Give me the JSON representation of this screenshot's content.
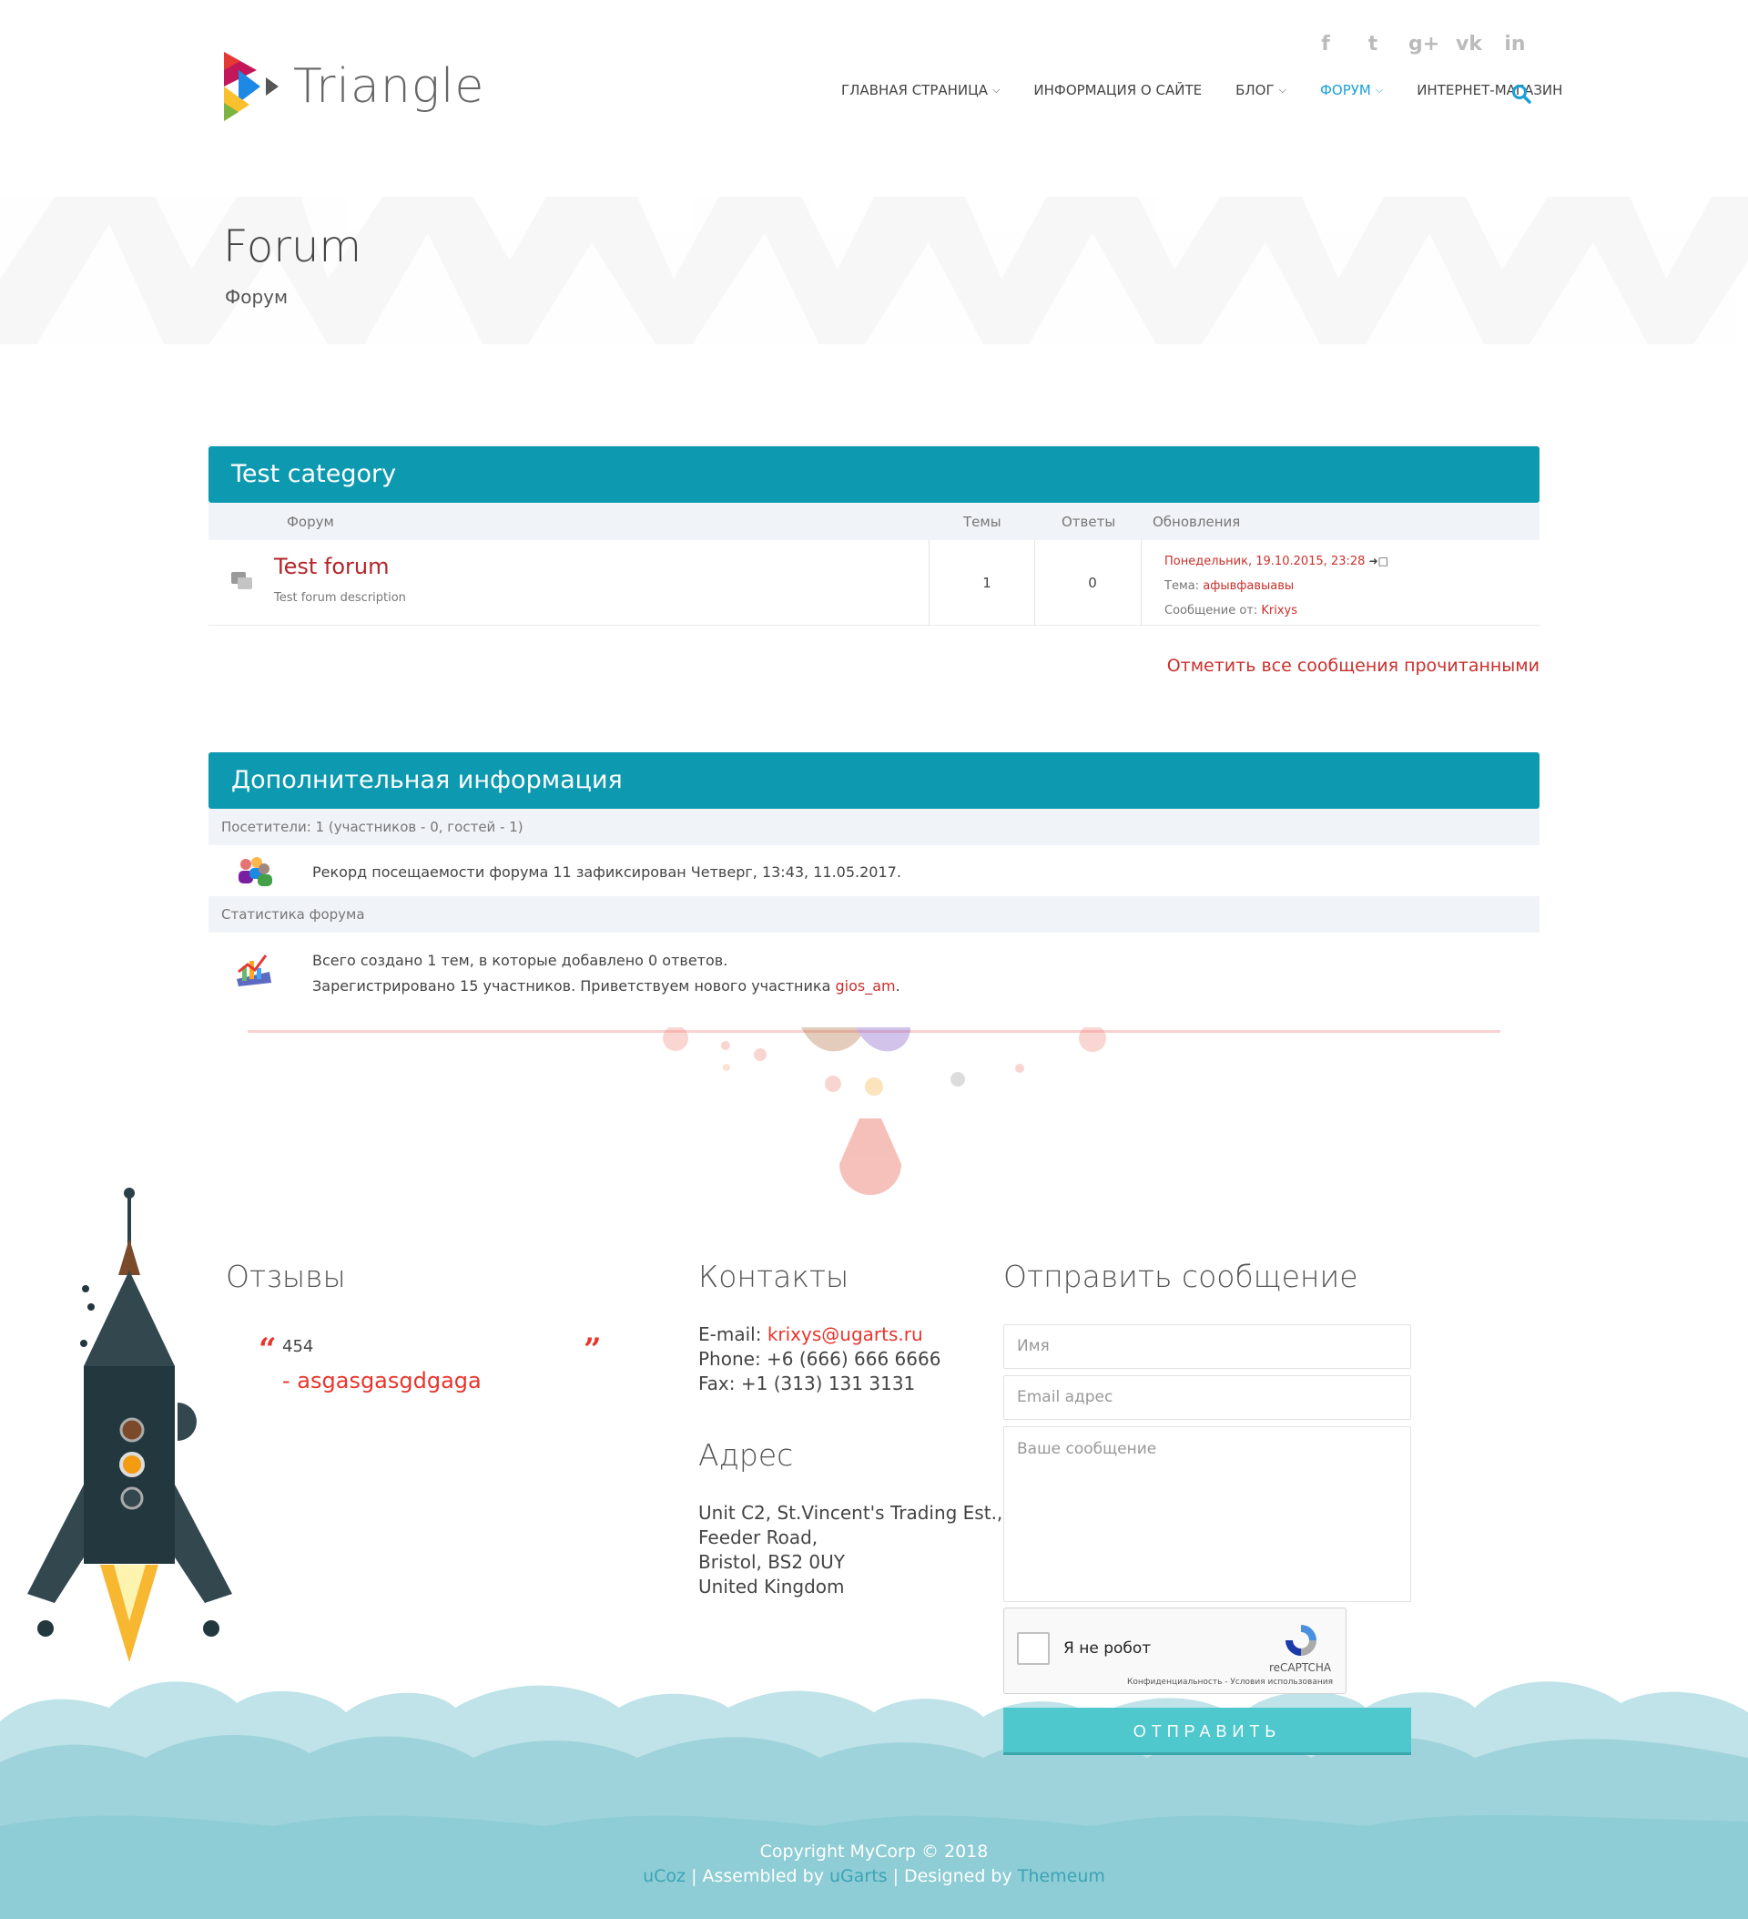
{
  "header": {
    "logo_text": "Triangle",
    "social": [
      "f",
      "t",
      "g+",
      "vk",
      "in"
    ],
    "nav": [
      {
        "label": "ГЛАВНАЯ СТРАНИЦА",
        "dropdown": true,
        "active": false
      },
      {
        "label": "ИНФОРМАЦИЯ О САЙТЕ",
        "dropdown": false,
        "active": false
      },
      {
        "label": "БЛОГ",
        "dropdown": true,
        "active": false
      },
      {
        "label": "ФОРУМ",
        "dropdown": true,
        "active": true
      },
      {
        "label": "ИНТЕРНЕТ-МАГАЗИН",
        "dropdown": false,
        "active": false
      }
    ],
    "chevron": "⌄"
  },
  "banner": {
    "title": "Forum",
    "subtitle": "Форум"
  },
  "forum": {
    "category_title": "Test category",
    "columns": {
      "forum": "Форум",
      "topics": "Темы",
      "replies": "Ответы",
      "updates": "Обновления"
    },
    "row": {
      "title": "Test forum",
      "description": "Test forum description",
      "topics": "1",
      "replies": "0",
      "last_date": "Понедельник, 19.10.2015, 23:28",
      "topic_label": "Тема:",
      "topic_value": "афывфавыавы",
      "author_label": "Сообщение от:",
      "author_value": "Krixys"
    },
    "mark_read": "Отметить все сообщения прочитанными"
  },
  "info": {
    "title": "Дополнительная информация",
    "visitors": "Посетители: 1  (участников - 0, гостей - 1)",
    "record": "Рекорд посещаемости форума 11 зафиксирован Четверг, 13:43, 11.05.2017.",
    "stats_title": "Статистика форума",
    "stats_line1": "Всего создано 1 тем, в которые добавлено 0 ответов.",
    "stats_line2_prefix": "Зарегистрировано 15 участников. Приветствуем нового участника ",
    "stats_line2_user": "gios_am",
    "stats_line2_suffix": "."
  },
  "footer": {
    "reviews_title": "Отзывы",
    "review_text": "454",
    "review_author": "- asgasgasgdgaga",
    "contacts_title": "Контакты",
    "email_label": "E-mail: ",
    "email_value": "krixys@ugarts.ru",
    "phone": "Phone: +6 (666) 666 6666",
    "fax": "Fax: +1 (313) 131 3131",
    "address_title": "Адрес",
    "address_lines": [
      "Unit C2, St.Vincent's Trading Est.,",
      "Feeder Road,",
      "Bristol, BS2 0UY",
      "United Kingdom"
    ],
    "send_title": "Отправить сообщение",
    "name_placeholder": "Имя",
    "email_placeholder": "Email адрес",
    "message_placeholder": "Ваше сообщение",
    "captcha_label": "Я не робот",
    "captcha_brand": "reCAPTCHA",
    "captcha_links": "Конфиденциальность - Условия использования",
    "send_button": "ОТПРАВИТЬ",
    "copyright": "Copyright MyCorp © 2018",
    "credit_ucoz": "uCoz",
    "credit_sep1": " | Assembled by ",
    "credit_ugarts": "uGarts",
    "credit_sep2": " | Designed by ",
    "credit_themeum": "Themeum"
  },
  "colors": {
    "accent": "#0d99b0",
    "link_red": "#c9302c",
    "nav_active": "#1a9fd8",
    "button": "#4fc8cd"
  }
}
